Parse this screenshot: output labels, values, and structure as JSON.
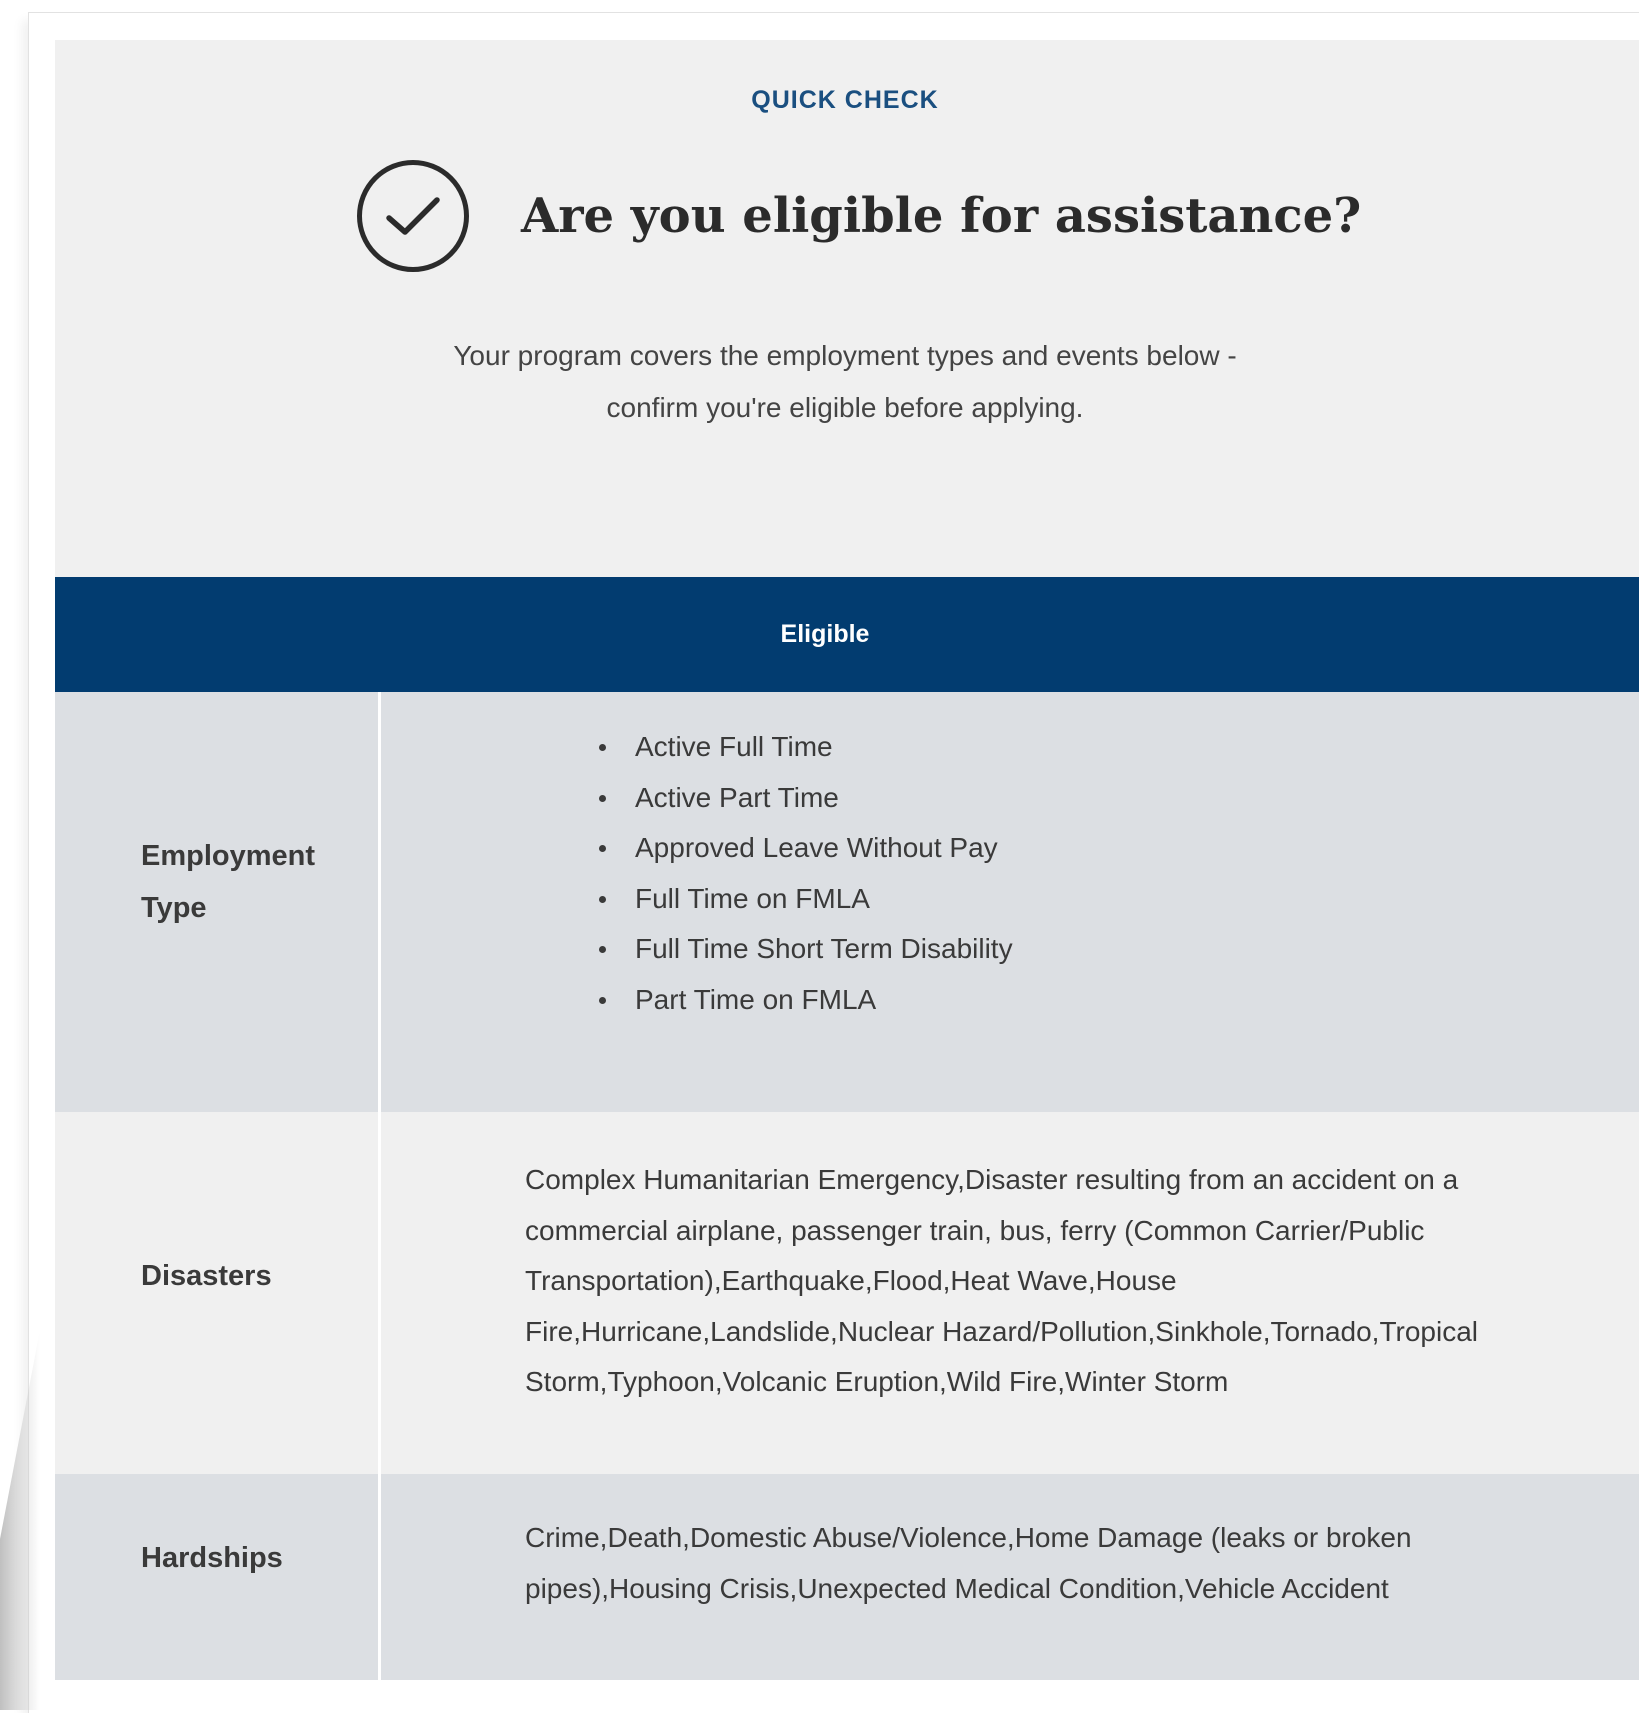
{
  "quick_check": {
    "eyebrow": "QUICK CHECK",
    "title": "Are you eligible for assistance?",
    "intro_lines": [
      "Your program covers the employment types and events below -",
      "confirm you're eligible before applying."
    ],
    "icon": "check-circle-icon"
  },
  "table": {
    "header": "Eligible",
    "header_color": "#023c70",
    "rows": {
      "employment": {
        "label_lines": [
          "Employment",
          "Type"
        ],
        "items": [
          "Active Full Time",
          "Active Part Time",
          "Approved Leave Without Pay",
          "Full Time on FMLA",
          "Full Time Short Term Disability",
          "Part Time on FMLA"
        ]
      },
      "disasters": {
        "label": "Disasters",
        "text_lines": [
          "Complex Humanitarian Emergency,Disaster resulting from an accident on a",
          "commercial airplane, passenger train, bus, ferry (Common Carrier/Public",
          "Transportation),Earthquake,Flood,Heat Wave,House",
          "Fire,Hurricane,Landslide,Nuclear Hazard/Pollution,Sinkhole,Tornado,Tropical",
          "Storm,Typhoon,Volcanic Eruption,Wild Fire,Winter Storm"
        ]
      },
      "hardships": {
        "label": "Hardships",
        "text_lines": [
          "Crime,Death,Domestic Abuse/Violence,Home Damage (leaks or broken",
          "pipes),Housing Crisis,Unexpected Medical Condition,Vehicle Accident"
        ]
      }
    }
  }
}
